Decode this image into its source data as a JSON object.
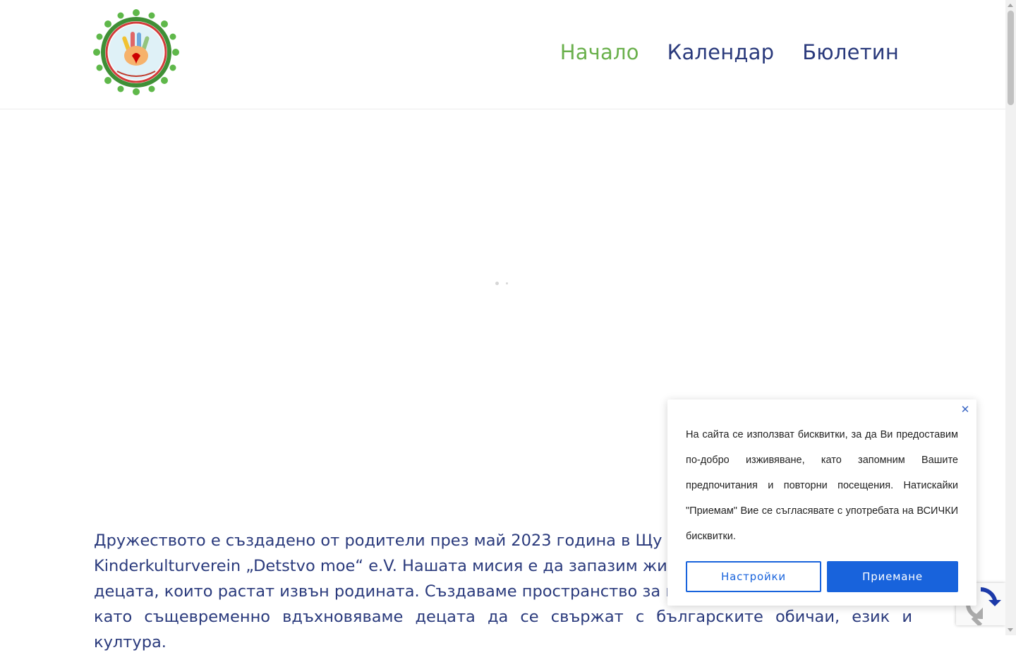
{
  "header": {
    "logo_alt": "Детство мое logo",
    "nav": [
      {
        "label": "Начало",
        "active": true
      },
      {
        "label": "Календар",
        "active": false
      },
      {
        "label": "Бюлетин",
        "active": false
      }
    ]
  },
  "intro": {
    "lines": [
      "Дружеството е създадено от родители през май 2023 година в Щу",
      "Kinderkulturverein „Detstvo moe“ e.V. Нашата мисия е да запазим жи",
      "децата, които растат извън родината. Създаваме пространство за из",
      "като същевременно вдъхновяваме децата да се свържат с българските обичаи, език и култура."
    ]
  },
  "cookie_banner": {
    "close_icon": "close-icon",
    "text": "На сайта се използват бисквитки, за да Ви предоставим по-добро изживяване, като запомним Вашите предпочитания и повторни посещения. Натискайки \"Приемам\" Вие се съгласявате с употребата на ВСИЧКИ бисквитки.",
    "settings_label": "Настройки",
    "accept_label": "Приемане"
  },
  "colors": {
    "nav_active": "#6ab04c",
    "nav_text": "#2a3a7c",
    "button_blue": "#1863dc"
  }
}
